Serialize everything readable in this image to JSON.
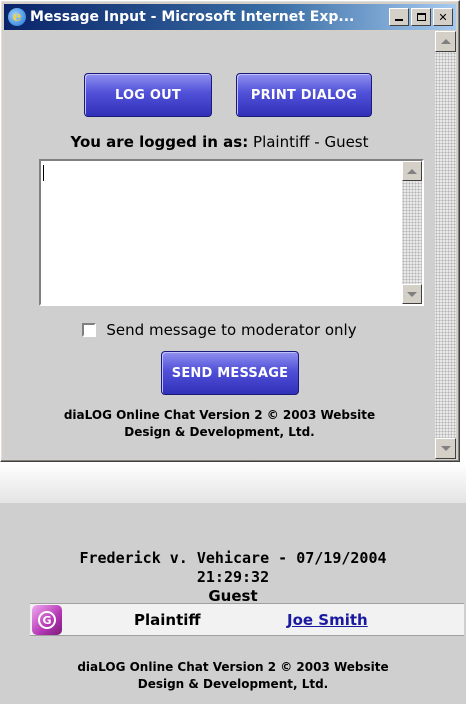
{
  "window": {
    "title": "Message Input - Microsoft Internet Exp...",
    "icon": "ie-icon"
  },
  "toolbar": {
    "logout_label": "LOG OUT",
    "print_label": "PRINT DIALOG"
  },
  "session": {
    "logged_in_prefix": "You are logged in as:",
    "logged_in_user": "Plaintiff - Guest"
  },
  "message": {
    "value": "",
    "moderator_only_label": "Send message to moderator only",
    "moderator_only_checked": false,
    "send_label": "SEND MESSAGE"
  },
  "footer": {
    "line1": "diaLOG Online Chat Version 2 © 2003 Website",
    "line2": "Design & Development, Ltd."
  },
  "chat": {
    "case_title_line1": "Frederick v. Vehicare - 07/19/2004",
    "case_title_line2": "21:29:32",
    "group_label": "Guest",
    "participants": [
      {
        "role": "Plaintiff",
        "name": "Joe Smith",
        "icon": "guest-g-icon"
      }
    ]
  },
  "colors": {
    "button_blue": "#5050d8",
    "titlebar": "#0a246a",
    "link": "#1a1aa0",
    "guest_icon": "#b436b4"
  }
}
